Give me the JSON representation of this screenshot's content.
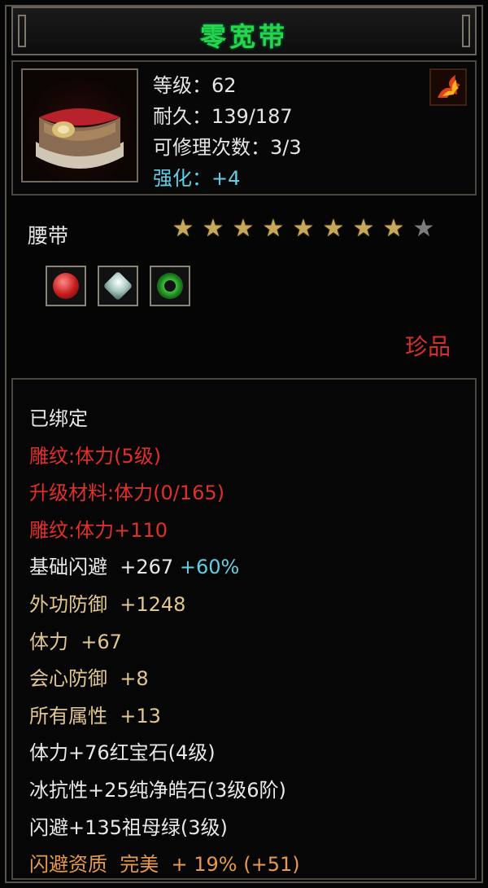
{
  "item": {
    "name": "零宽带",
    "stats": [
      {
        "label": "等级",
        "value": "62"
      },
      {
        "label": "耐久",
        "value": "139/187"
      },
      {
        "label": "可修理次数",
        "value": "3/3"
      }
    ],
    "enhance": {
      "label": "强化",
      "value": "+4"
    },
    "type": "腰带",
    "stars_filled": 8,
    "stars_total": 9,
    "gems": [
      "ruby-gem-icon",
      "diamond-gem-icon",
      "emerald-gem-icon"
    ],
    "rarity": "珍品"
  },
  "attributes": {
    "bound": "已绑定",
    "engrave": "雕纹:体力(5级)",
    "upgrade_material": "升级材料:体力(0/165)",
    "engrave_bonus": "雕纹:体力+110",
    "base_dodge": {
      "label": "基础闪避",
      "value": "+267",
      "bonus": "+60%"
    },
    "outer_defense": {
      "label": "外功防御",
      "value": "+1248"
    },
    "stamina": {
      "label": "体力",
      "value": "+67"
    },
    "crit_defense": {
      "label": "会心防御",
      "value": "+8"
    },
    "all_attributes": {
      "label": "所有属性",
      "value": "+13"
    },
    "gem_line_1": "体力+76红宝石(4级)",
    "gem_line_2": "冰抗性+25纯净皓石(3级6阶)",
    "gem_line_3": "闪避+135祖母绿(3级)",
    "dodge_quality": {
      "label": "闪避资质",
      "grade": "完美",
      "value": "+ 19% (+51)"
    }
  },
  "colors": {
    "title": "#27d54b",
    "engrave": "#e0302a",
    "attribute": "#e2c690",
    "quality": "#e89a4a",
    "enhance": "#5fd0e6"
  }
}
